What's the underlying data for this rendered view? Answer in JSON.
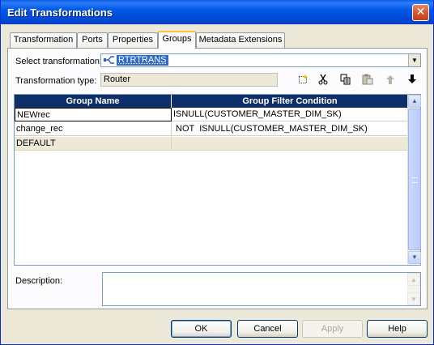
{
  "window": {
    "title": "Edit Transformations",
    "close_glyph": "✕"
  },
  "tabs": [
    {
      "label": "Transformation"
    },
    {
      "label": "Ports"
    },
    {
      "label": "Properties"
    },
    {
      "label": "Groups",
      "active": true
    },
    {
      "label": "Metadata Extensions"
    }
  ],
  "select_transformation": {
    "label": "Select transformation:",
    "value": "RTRTRANS",
    "icon": "router-icon"
  },
  "transformation_type": {
    "label": "Transformation type:",
    "value": "Router"
  },
  "toolbar": {
    "icons": [
      "new-group-icon",
      "cut-icon",
      "copy-icon",
      "paste-icon",
      "move-up-icon",
      "move-down-icon"
    ]
  },
  "grid": {
    "columns": [
      "Group Name",
      "Group Filter Condition"
    ],
    "rows": [
      {
        "name": "NEWrec",
        "condition": "ISNULL(CUSTOMER_MASTER_DIM_SK)"
      },
      {
        "name": "change_rec",
        "condition": " NOT  ISNULL(CUSTOMER_MASTER_DIM_SK)"
      },
      {
        "name": "DEFAULT",
        "condition": ""
      }
    ]
  },
  "description": {
    "label": "Description:",
    "value": ""
  },
  "buttons": {
    "ok": "OK",
    "cancel": "Cancel",
    "apply": "Apply",
    "help": "Help"
  },
  "colors": {
    "titlebar": "#0058e6",
    "grid_header": "#0f2f6b",
    "selection": "#316ac5",
    "dialog_bg": "#ece9d8"
  }
}
